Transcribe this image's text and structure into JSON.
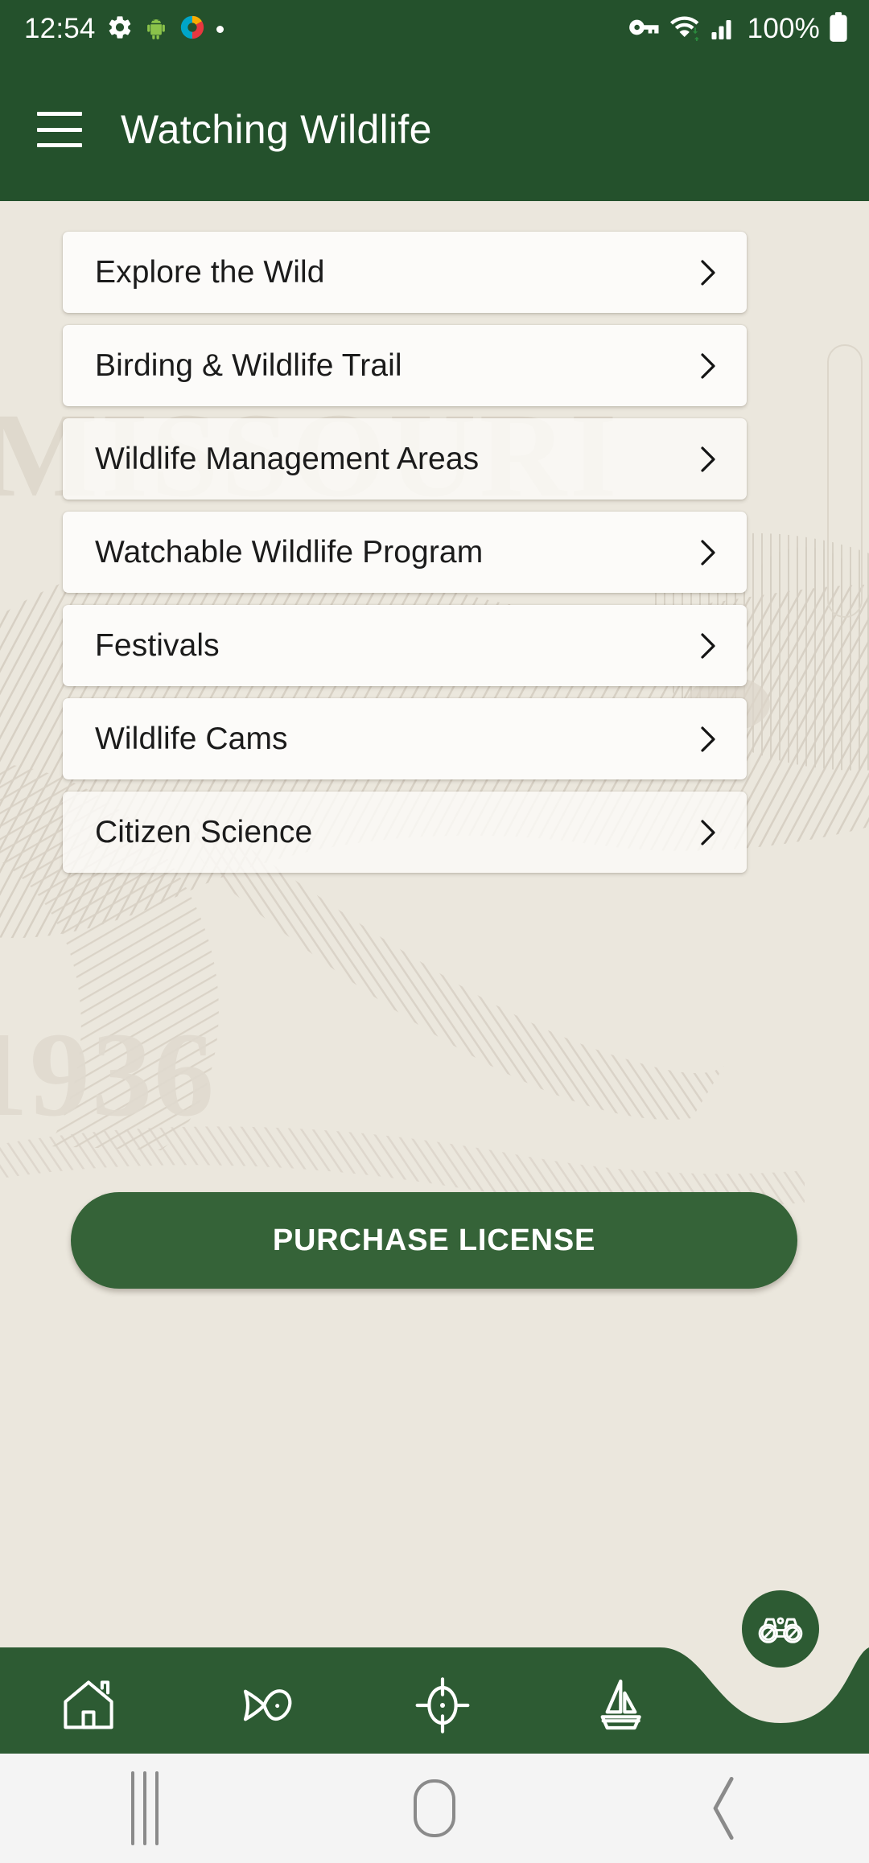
{
  "status_bar": {
    "time": "12:54",
    "battery_percent": "100%",
    "left_icons": [
      "settings-gear-icon",
      "android-robot-icon",
      "app-badge-icon",
      "notification-dot-icon"
    ],
    "right_icons": [
      "vpn-key-icon",
      "wifi-icon",
      "cellular-signal-icon",
      "battery-icon"
    ],
    "background_color": "#24512c"
  },
  "app_bar": {
    "menu_icon": "hamburger-menu-icon",
    "title": "Watching Wildlife",
    "background_color": "#24512c",
    "text_color": "#ffffff"
  },
  "background": {
    "page_color": "#ebe7dd",
    "artwork": "engraved-bear-illustration",
    "artwork_color": "#d8d2c8",
    "watermark_text_1": "MISSOURI",
    "watermark_text_2": "1936"
  },
  "menu": {
    "items": [
      {
        "label": "Explore the Wild",
        "chevron": "chevron-right-icon"
      },
      {
        "label": "Birding & Wildlife Trail",
        "chevron": "chevron-right-icon"
      },
      {
        "label": "Wildlife Management Areas",
        "chevron": "chevron-right-icon"
      },
      {
        "label": "Watchable Wildlife Program",
        "chevron": "chevron-right-icon"
      },
      {
        "label": "Festivals",
        "chevron": "chevron-right-icon"
      },
      {
        "label": "Wildlife Cams",
        "chevron": "chevron-right-icon"
      },
      {
        "label": "Citizen Science",
        "chevron": "chevron-right-icon"
      }
    ],
    "card_color": "#fcfbf9"
  },
  "purchase_button": {
    "label": "PURCHASE LICENSE",
    "background_color": "#356338",
    "text_color": "#ffffff"
  },
  "bottom_nav": {
    "background_color": "#2d5b33",
    "items": [
      {
        "icon": "home-icon",
        "name": "home"
      },
      {
        "icon": "fish-icon",
        "name": "fishing"
      },
      {
        "icon": "crosshair-target-icon",
        "name": "hunting"
      },
      {
        "icon": "sailboat-icon",
        "name": "boating"
      }
    ],
    "fab": {
      "icon": "binoculars-icon",
      "name": "watching-wildlife"
    }
  },
  "android_nav": {
    "recents": "recents-icon",
    "home": "home-pill-icon",
    "back": "back-chevron-icon",
    "background_color": "#f4f4f4"
  }
}
